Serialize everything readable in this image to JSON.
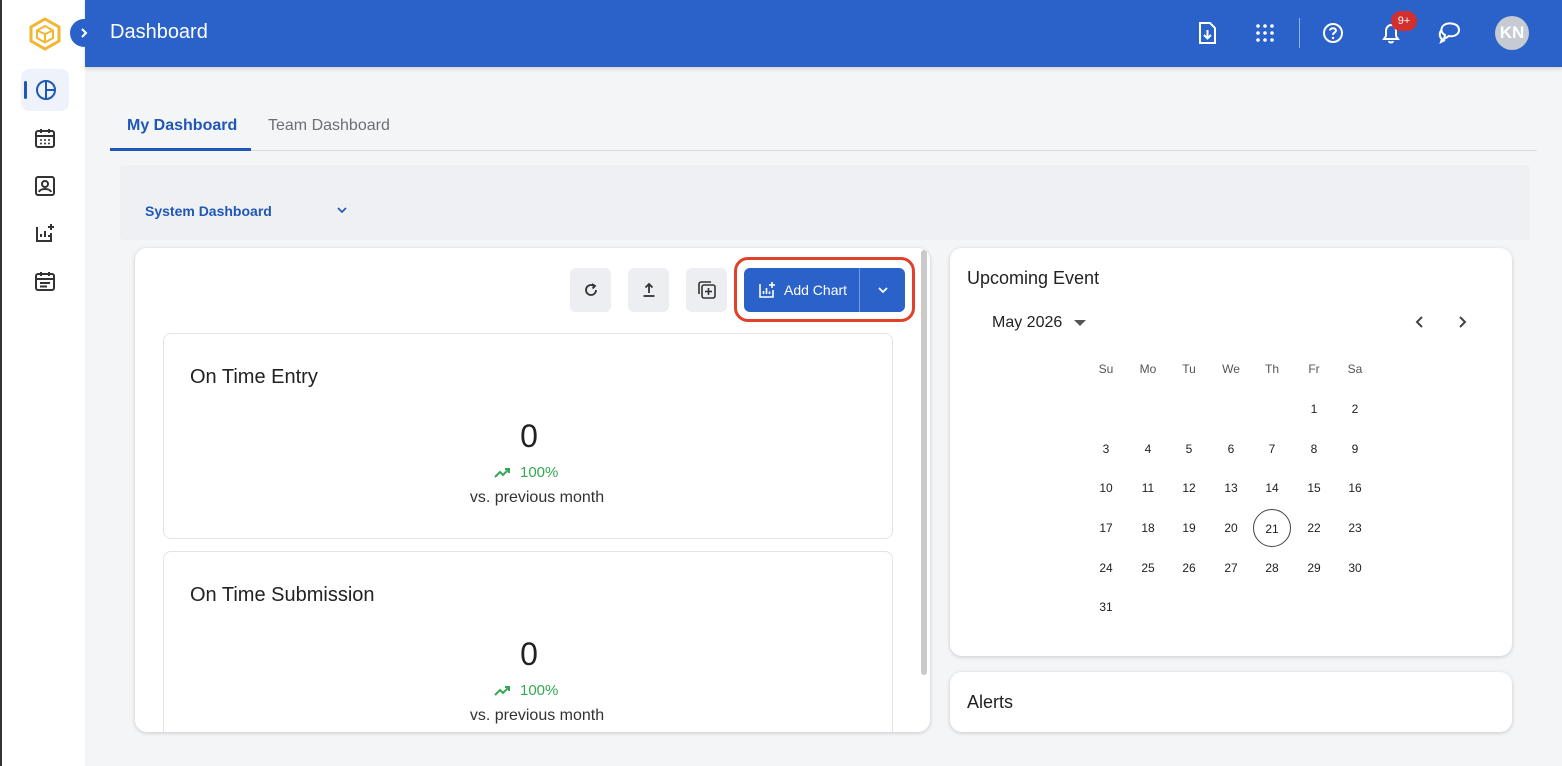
{
  "header": {
    "title": "Dashboard",
    "notification_badge": "9+",
    "avatar_initials": "KN"
  },
  "tabs": [
    {
      "label": "My Dashboard",
      "active": true
    },
    {
      "label": "Team Dashboard",
      "active": false
    }
  ],
  "dashboard_selector": {
    "value": "System Dashboard"
  },
  "toolbar": {
    "add_chart_label": "Add Chart"
  },
  "metrics": [
    {
      "title": "On Time Entry",
      "value": "0",
      "trend": "100%",
      "comparison": "vs. previous month"
    },
    {
      "title": "On Time Submission",
      "value": "0",
      "trend": "100%",
      "comparison": "vs. previous month"
    }
  ],
  "events": {
    "title": "Upcoming Event",
    "month_label": "May 2026",
    "weekdays": [
      "Su",
      "Mo",
      "Tu",
      "We",
      "Th",
      "Fr",
      "Sa"
    ],
    "first_weekday_index": 5,
    "days_in_month": 31,
    "today": 21
  },
  "alerts": {
    "title": "Alerts"
  },
  "colors": {
    "brand": "#2a62c9",
    "accent_text": "#1f57b8",
    "trend_up": "#34a853",
    "highlight_outline": "#e0412a",
    "badge": "#d32f2f"
  }
}
